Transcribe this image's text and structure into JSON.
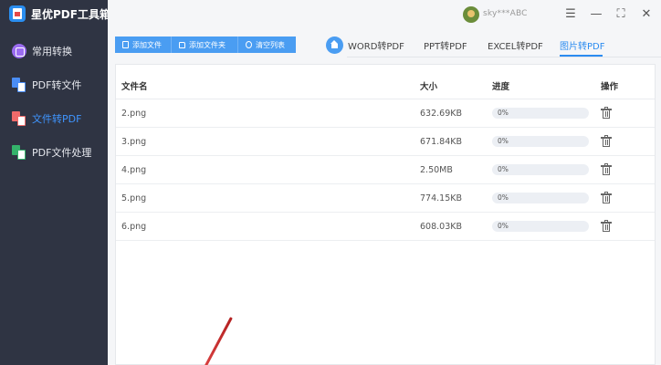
{
  "app": {
    "title": "星优PDF工具箱"
  },
  "sidebar": {
    "items": [
      {
        "label": "常用转换",
        "icon": "common-convert-icon"
      },
      {
        "label": "PDF转文件",
        "icon": "pdf-to-file-icon"
      },
      {
        "label": "文件转PDF",
        "icon": "file-to-pdf-icon",
        "active": true
      },
      {
        "label": "PDF文件处理",
        "icon": "pdf-process-icon"
      }
    ]
  },
  "header": {
    "username": "sky***ABC",
    "window_buttons": [
      "☰",
      "—",
      "⛶",
      "✕"
    ]
  },
  "toolbar": {
    "add_file": "添加文件",
    "add_folder": "添加文件夹",
    "clear_list": "清空列表"
  },
  "tabs": [
    {
      "label": "WORD转PDF"
    },
    {
      "label": "PPT转PDF"
    },
    {
      "label": "EXCEL转PDF"
    },
    {
      "label": "图片转PDF",
      "active": true
    }
  ],
  "table": {
    "headers": {
      "name": "文件名",
      "size": "大小",
      "progress": "进度",
      "action": "操作"
    },
    "rows": [
      {
        "name": "2.png",
        "size": "632.69KB",
        "progress": "0%",
        "progress_value": 0
      },
      {
        "name": "3.png",
        "size": "671.84KB",
        "progress": "0%",
        "progress_value": 0
      },
      {
        "name": "4.png",
        "size": "2.50MB",
        "progress": "0%",
        "progress_value": 0
      },
      {
        "name": "5.png",
        "size": "774.15KB",
        "progress": "0%",
        "progress_value": 0
      },
      {
        "name": "6.png",
        "size": "608.03KB",
        "progress": "0%",
        "progress_value": 0
      }
    ]
  },
  "colors": {
    "accent": "#4a9df2",
    "sidebar_bg": "#2f3443",
    "active_nav": "#3f95ff"
  }
}
